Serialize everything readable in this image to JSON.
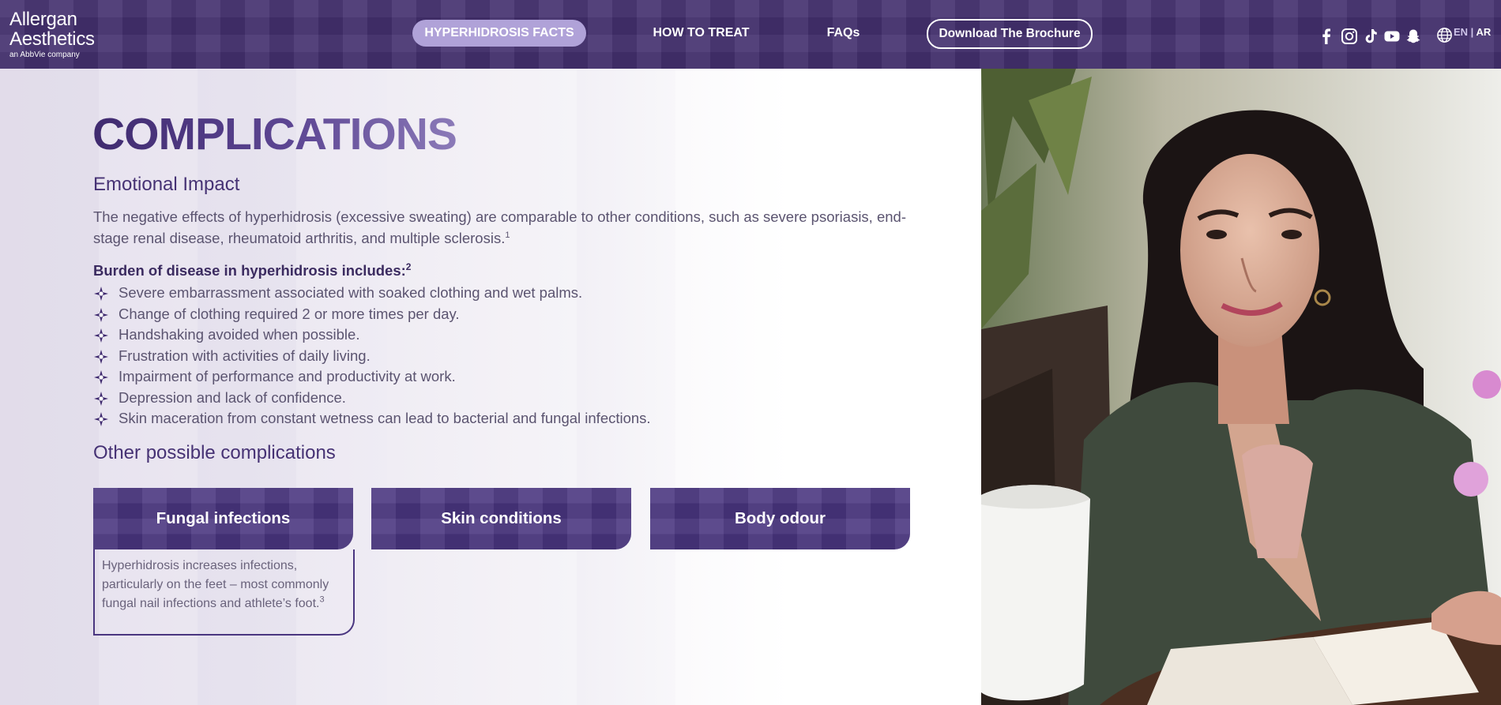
{
  "header": {
    "logo": {
      "line1": "Allergan",
      "line2": "Aesthetics",
      "sub": "an AbbVie company"
    },
    "nav": [
      {
        "label": "HYPERHIDROSIS FACTS",
        "active": true
      },
      {
        "label": "HOW TO TREAT"
      },
      {
        "label": "FAQs"
      }
    ],
    "cta_label": "Download The Brochure",
    "social_icons": [
      "facebook-icon",
      "instagram-icon",
      "tiktok-icon",
      "youtube-icon",
      "snapchat-icon"
    ],
    "lang": {
      "en": "EN",
      "separator": " | ",
      "ar": "AR"
    }
  },
  "main": {
    "title": "COMPLICATIONS",
    "emotional": {
      "heading": "Emotional Impact",
      "paragraph": "The negative effects of hyperhidrosis (excessive sweating) are comparable to other conditions, such as severe psoriasis, end-stage renal disease, rheumatoid arthritis, and multiple sclerosis.",
      "paragraph_ref": "1"
    },
    "burden": {
      "heading": "Burden of disease in hyperhidrosis includes:",
      "ref": "2"
    },
    "bullets": [
      "Severe embarrassment associated with soaked clothing and wet palms.",
      "Change of clothing required 2 or more times per day.",
      "Handshaking avoided when possible.",
      "Frustration with activities of daily living.",
      "Impairment of performance and productivity at work.",
      "Depression and lack of confidence.",
      "Skin maceration from constant wetness can lead to bacterial and fungal infections."
    ],
    "other_heading": "Other possible complications",
    "cards": [
      {
        "label": "Fungal infections",
        "expanded": true,
        "body": "Hyperhidrosis increases infections, particularly on the feet – most commonly fungal nail infections and athlete’s foot.",
        "ref": "3"
      },
      {
        "label": "Skin conditions",
        "expanded": false
      },
      {
        "label": "Body odour",
        "expanded": false
      }
    ]
  },
  "colors": {
    "brand_purple": "#44306e",
    "active_pill": "#b0a2d8",
    "text_body": "#5b5470",
    "heading": "#463274"
  }
}
